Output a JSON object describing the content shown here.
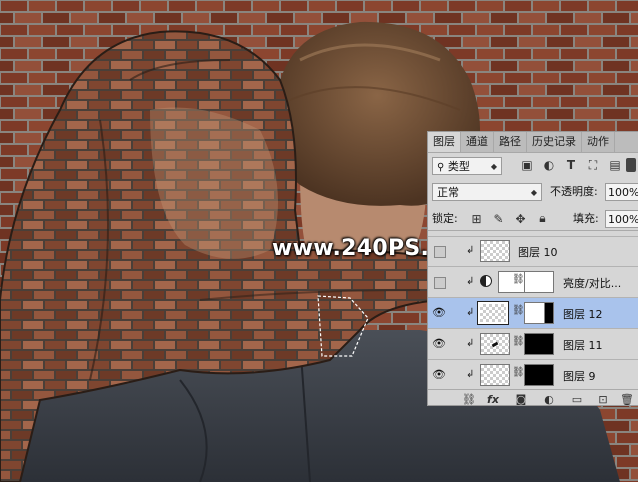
{
  "watermark": {
    "text": "www.240PS.com"
  },
  "layers_panel": {
    "tabs": [
      {
        "label": "图层",
        "active": true
      },
      {
        "label": "通道",
        "active": false
      },
      {
        "label": "路径",
        "active": false
      },
      {
        "label": "历史记录",
        "active": false
      },
      {
        "label": "动作",
        "active": false
      }
    ],
    "filter": {
      "kind_label": "类型",
      "icons": [
        "image-filter-icon",
        "adjustment-filter-icon",
        "type-filter-icon",
        "shape-filter-icon",
        "smart-object-filter-icon"
      ]
    },
    "blend_mode": "正常",
    "opacity_label": "不透明度:",
    "opacity_value": "100%",
    "lock_label": "锁定:",
    "fill_label": "填充:",
    "fill_value": "100%",
    "layers": [
      {
        "name": "图层 10",
        "visible": false,
        "clipped": true,
        "type": "pixel",
        "mask": null,
        "selected": false
      },
      {
        "name": "亮度/对比...",
        "visible": false,
        "clipped": true,
        "type": "adjustment",
        "mask": "white",
        "selected": false
      },
      {
        "name": "图层 12",
        "visible": true,
        "clipped": true,
        "type": "pixel",
        "mask": "white-black-edge",
        "selected": true
      },
      {
        "name": "图层 11",
        "visible": true,
        "clipped": true,
        "type": "pixel",
        "mask": "black",
        "selected": false
      },
      {
        "name": "图层 9",
        "visible": true,
        "clipped": true,
        "type": "pixel",
        "mask": "black",
        "selected": false
      }
    ],
    "bottom_icons": [
      "link-icon",
      "fx-icon",
      "add-mask-icon",
      "new-adjustment-icon",
      "new-group-icon",
      "new-layer-icon",
      "delete-icon"
    ],
    "bottom_fx_label": "fx"
  },
  "colors": {
    "selected_row": "#a9c3ec",
    "panel_bg": "#d6d6d6",
    "brick": "#7a3a26",
    "mortar": "#8b8580"
  }
}
